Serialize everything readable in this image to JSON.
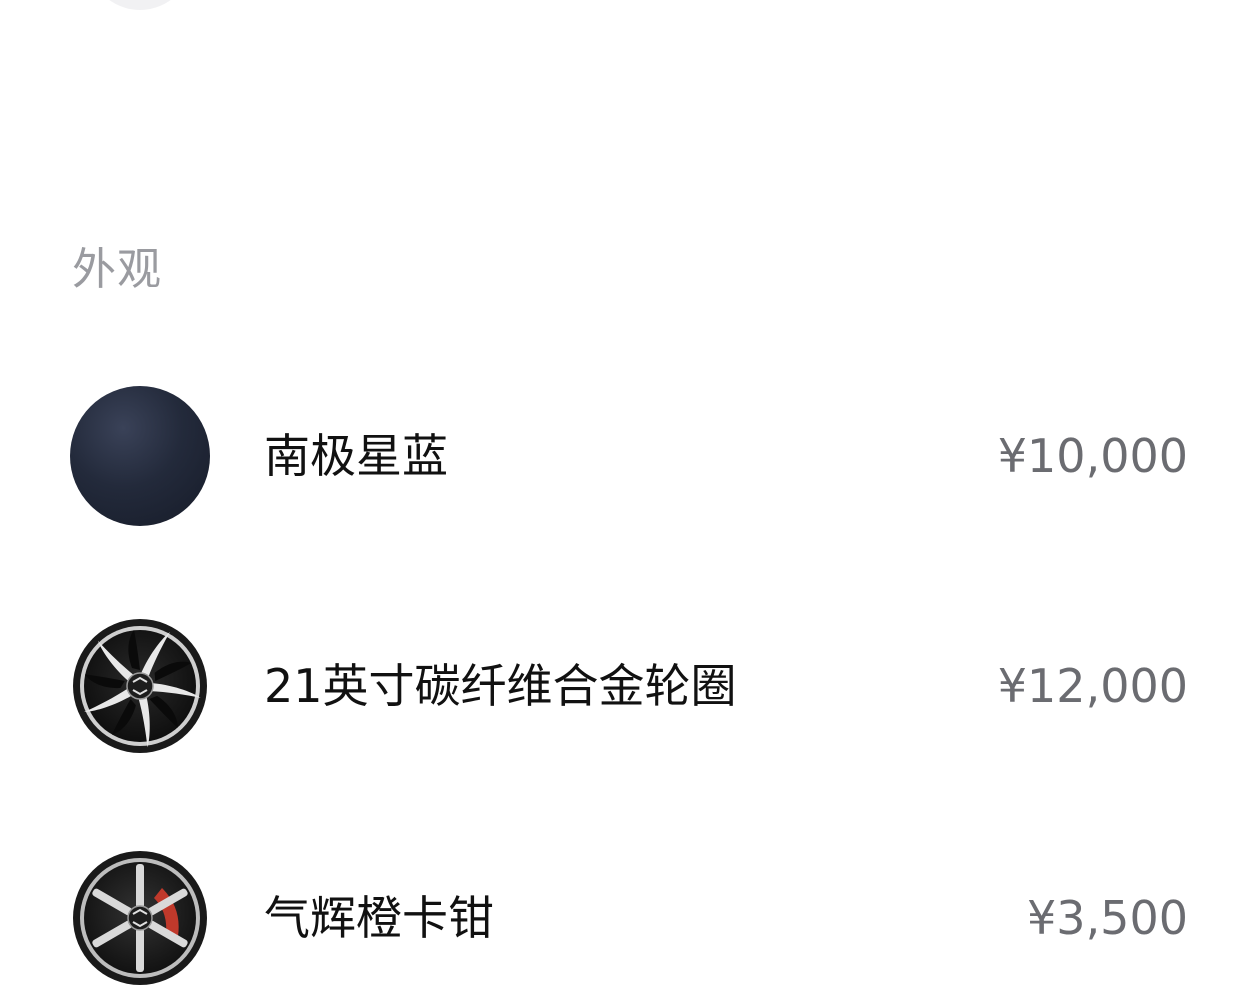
{
  "section": {
    "title": "外观"
  },
  "options": [
    {
      "label": "南极星蓝",
      "price": "¥10,000",
      "icon": "color-swatch-icon",
      "swatch_color": "#1e2434"
    },
    {
      "label": "21英寸碳纤维合金轮圈",
      "price": "¥12,000",
      "icon": "wheel-icon"
    },
    {
      "label": "气辉橙卡钳",
      "price": "¥3,500",
      "icon": "brake-caliper-wheel-icon",
      "caliper_color": "#c0392b"
    }
  ]
}
